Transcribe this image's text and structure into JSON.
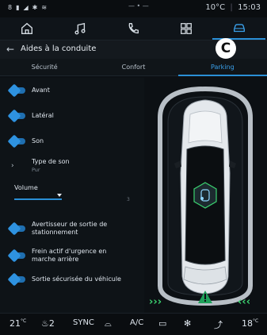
{
  "status": {
    "left_icons": [
      "8",
      "▮",
      "◢",
      "✱",
      "≋"
    ],
    "center": "— • —",
    "temperature": "10°C",
    "time": "15:03"
  },
  "nav": [
    {
      "name": "home-icon"
    },
    {
      "name": "music-icon"
    },
    {
      "name": "phone-icon"
    },
    {
      "name": "apps-icon"
    },
    {
      "name": "car-icon",
      "active": true
    }
  ],
  "header": {
    "back": "←",
    "title": "Aides à la conduite"
  },
  "badge": "C",
  "tabs": [
    {
      "label": "Sécurité",
      "active": false
    },
    {
      "label": "Confort",
      "active": false
    },
    {
      "label": "Parking",
      "active": true
    }
  ],
  "settings": {
    "avant": "Avant",
    "lateral": "Latéral",
    "son": "Son",
    "type_de_son": "Type de son",
    "type_de_son_value": "Pur",
    "volume_label": "Volume",
    "volume_value": 3,
    "avertisseur_line1": "Avertisseur de sortie de",
    "avertisseur_line2": "stationnement",
    "frein_line1": "Frein actif d'urgence en",
    "frein_line2": "marche arrière",
    "sortie": "Sortie sécurisée du véhicule"
  },
  "bottom": {
    "left_temp": "21",
    "left_temp_unit": "°C",
    "seat_level": "2",
    "sync": "SYNC",
    "ac": "A/C",
    "right_temp": "18",
    "right_temp_unit": "°C"
  },
  "colors": {
    "accent": "#2a8fd6",
    "parking_green": "#3bd16f",
    "warning_green": "#1fa05a"
  }
}
